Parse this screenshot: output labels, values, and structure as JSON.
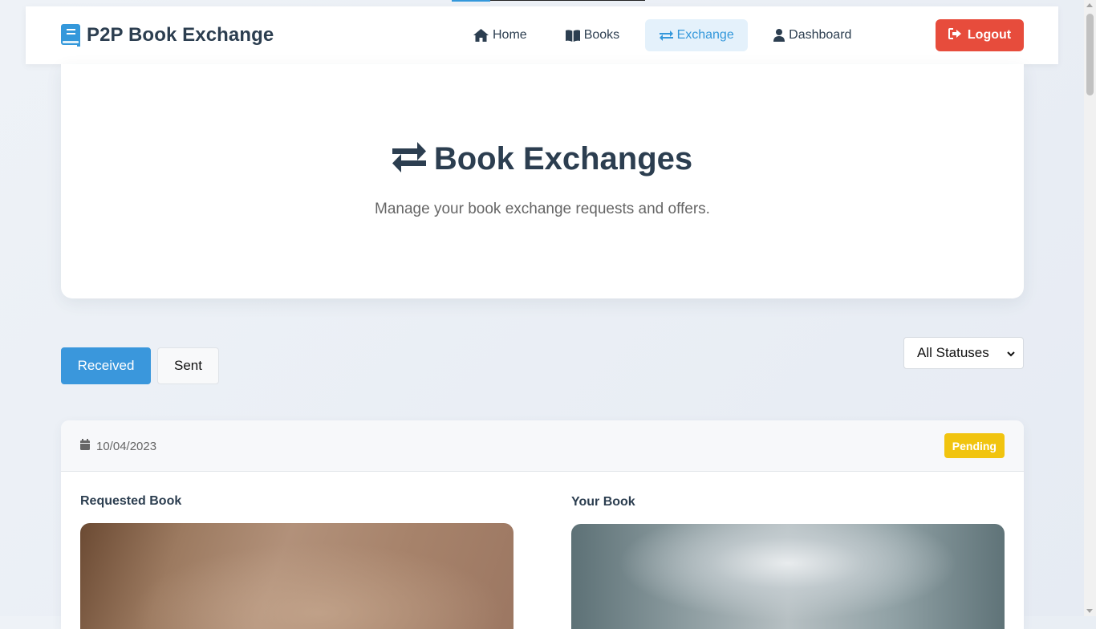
{
  "brand": {
    "name": "P2P Book Exchange",
    "icon": "book-icon",
    "icon_color": "#3498db"
  },
  "nav": {
    "items": [
      {
        "label": "Home",
        "icon": "home-icon"
      },
      {
        "label": "Books",
        "icon": "open-book-icon"
      },
      {
        "label": "Exchange",
        "icon": "exchange-arrows-icon",
        "active": true
      },
      {
        "label": "Dashboard",
        "icon": "user-icon"
      }
    ],
    "logout_label": "Logout",
    "logout_icon": "sign-out-icon"
  },
  "hero": {
    "title": "Book Exchanges",
    "title_icon": "exchange-arrows-icon",
    "subtitle": "Manage your book exchange requests and offers."
  },
  "tabs": {
    "received_label": "Received",
    "sent_label": "Sent",
    "active": "Received"
  },
  "filter": {
    "selected": "All Statuses"
  },
  "exchange_card": {
    "date": "10/04/2023",
    "date_icon": "calendar-icon",
    "status": "Pending",
    "requested_label": "Requested Book",
    "your_label": "Your Book"
  },
  "colors": {
    "accent": "#3498db",
    "danger": "#e74c3c",
    "pending": "#f1c40f",
    "text": "#2c3e50"
  }
}
